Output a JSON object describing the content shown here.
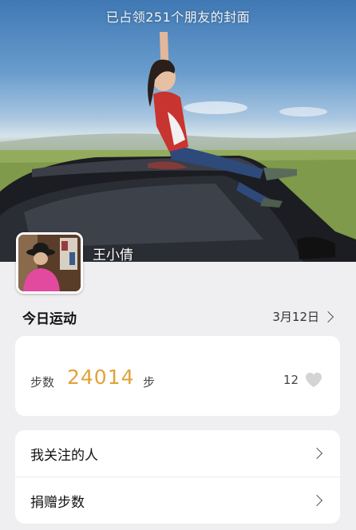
{
  "cover": {
    "caption": "已占领251个朋友的封面",
    "user_name": "王小倩"
  },
  "today": {
    "title": "今日运动",
    "date": "3月12日"
  },
  "steps": {
    "label": "步数",
    "value": "24014",
    "unit": "步",
    "likes": "12"
  },
  "menu": {
    "items": [
      {
        "label": "我关注的人"
      },
      {
        "label": "捐赠步数"
      }
    ]
  },
  "colors": {
    "accent": "#e0a33a",
    "background": "#efeff1",
    "card": "#ffffff"
  }
}
